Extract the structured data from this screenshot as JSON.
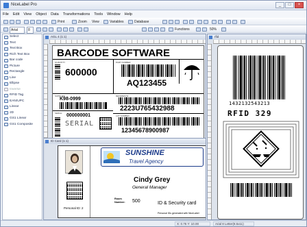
{
  "app": {
    "title": "NiceLabel Pro"
  },
  "menu": [
    "File",
    "Edit",
    "View",
    "Object",
    "Data",
    "Transformations",
    "Tools",
    "Window",
    "Help"
  ],
  "toolbar1": {
    "print_label": "Print",
    "zoom_label": "Zoom",
    "view_label": "View",
    "variables_label": "Variables",
    "database_label": "Database"
  },
  "toolbar2": {
    "font_name": "Arial",
    "font_size": "8",
    "functions_label": "Functions",
    "zoom_value": "50%"
  },
  "sidebar": {
    "items": [
      {
        "label": "Select"
      },
      {
        "label": "Text"
      },
      {
        "label": "Text Box"
      },
      {
        "label": "Rich Text Box"
      },
      {
        "label": "Bar code"
      },
      {
        "label": "Picture"
      },
      {
        "label": "Rectangle"
      },
      {
        "label": "Line"
      },
      {
        "label": "Ellipse"
      },
      {
        "label": "Inverse"
      },
      {
        "label": "RFID Tag"
      },
      {
        "label": "EAN/UPC"
      },
      {
        "label": "Linear"
      },
      {
        "label": "2D"
      },
      {
        "label": "GS1 Linear"
      },
      {
        "label": "GS1 Composite"
      }
    ]
  },
  "doc1": {
    "title": "AGL 4 (1:1)",
    "header": "BARCODE SOFTWARE",
    "field1_small": "QUANTITY",
    "quantity": "600000",
    "field2_small": "PART NUMBER",
    "part_number": "AQ123455",
    "field3_small": "SUPPLIER",
    "supplier": "K98-0999",
    "serial_small": "SERIAL",
    "serial_value": "000000001",
    "serial_big": "SERIAL",
    "ref_small": "REFERENCE",
    "reference": "2223U765432988",
    "lot_small": "LOT NUMBER",
    "lot": "12345678900987"
  },
  "doc2": {
    "title": "ID Card (1:1)",
    "company": "SUNSHINE",
    "tagline": "Travel Agency",
    "person_name": "Cindy Grey",
    "person_role": "General Manager",
    "room_label": "Room Number:",
    "room_value": "500",
    "card_type": "ID & Security card",
    "personal_id": "Personal ID: 2",
    "footer": "Personal IDs generated with NiceLabel"
  },
  "doc3": {
    "title": "rfid",
    "barcode_text": "1432132543213",
    "rfid_label": "RFID 329"
  },
  "status": {
    "coords": "X: 0.75 Y: 10.00",
    "printer": "Arial 8 Letter(8.5x11)"
  },
  "colors": {
    "accent": "#3b7bd6",
    "window_frame": "#8a9ab8",
    "card_accent": "#1a3a8a"
  }
}
